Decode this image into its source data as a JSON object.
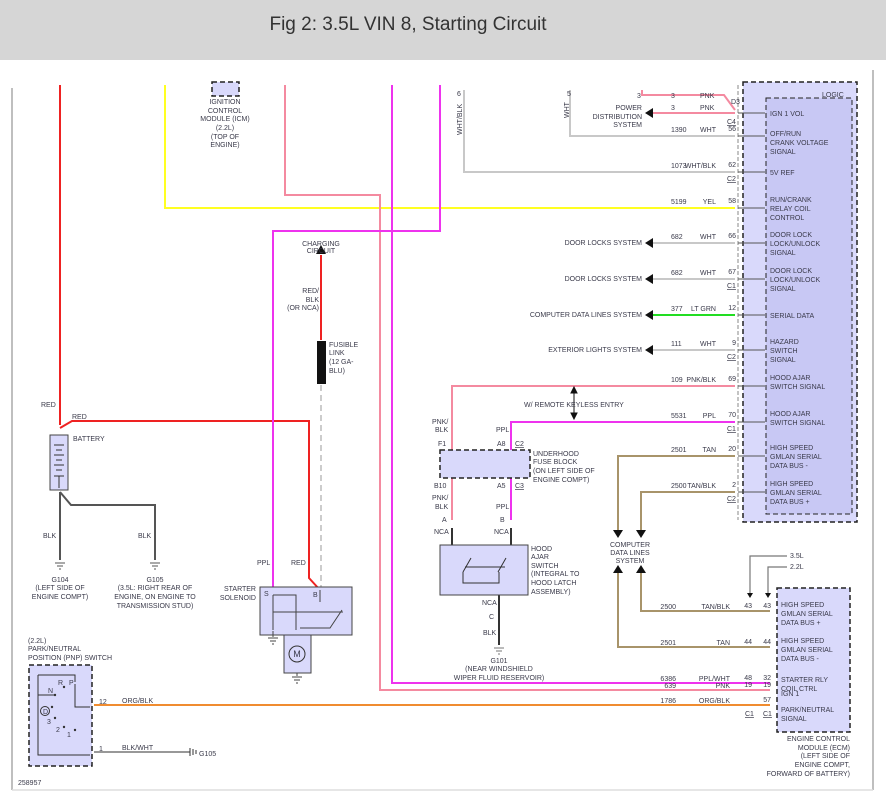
{
  "title": "Fig 2: 3.5L VIN 8, Starting Circuit",
  "figure_id": "258957",
  "colors": {
    "red": "#ee2222",
    "yellow": "#ffff22",
    "pink": "#f48aa0",
    "magenta": "#ee33ee",
    "white": "#c8c8c8",
    "ltgrn": "#22dd22",
    "tan": "#a8946a",
    "orange": "#f08c30",
    "black": "#333333",
    "module_fill": "#d9d9fb"
  },
  "bcm": {
    "logic": "LOGIC",
    "pins": [
      {
        "circuit": "3",
        "color": "PNK",
        "pin": "D3",
        "conn": "C4",
        "signal": [
          "IGN 1 VOL"
        ],
        "dest": [
          "POWER",
          "DISTRIBUTION",
          "SYSTEM"
        ]
      },
      {
        "circuit": "1390",
        "color": "WHT",
        "pin": "56",
        "signal": [
          "OFF/RUN",
          "CRANK VOLTAGE",
          "SIGNAL"
        ]
      },
      {
        "circuit": "1073",
        "color": "WHT/BLK",
        "pin": "62",
        "conn": "C2",
        "signal": [
          "5V REF"
        ]
      },
      {
        "circuit": "5199",
        "color": "YEL",
        "pin": "58",
        "signal": [
          "RUN/CRANK",
          "RELAY COIL",
          "CONTROL"
        ]
      },
      {
        "circuit": "682",
        "color": "WHT",
        "pin": "66",
        "signal": [
          "DOOR LOCK",
          "LOCK/UNLOCK",
          "SIGNAL"
        ],
        "dest": "DOOR LOCKS SYSTEM"
      },
      {
        "circuit": "682",
        "color": "WHT",
        "pin": "67",
        "conn": "C1",
        "signal": [
          "DOOR LOCK",
          "LOCK/UNLOCK",
          "SIGNAL"
        ],
        "dest": "DOOR LOCKS SYSTEM"
      },
      {
        "circuit": "377",
        "color": "LT GRN",
        "pin": "12",
        "signal": [
          "SERIAL DATA"
        ],
        "dest": "COMPUTER DATA LINES SYSTEM"
      },
      {
        "circuit": "111",
        "color": "WHT",
        "pin": "9",
        "conn": "C2",
        "signal": [
          "HAZARD",
          "SWITCH",
          "SIGNAL"
        ],
        "dest": "EXTERIOR LIGHTS SYSTEM"
      },
      {
        "circuit": "109",
        "color": "PNK/BLK",
        "pin": "69",
        "signal": [
          "HOOD AJAR",
          "SWITCH SIGNAL"
        ]
      },
      {
        "circuit": "5531",
        "color": "PPL",
        "pin": "70",
        "conn": "C1",
        "signal": [
          "HOOD AJAR",
          "SWITCH SIGNAL"
        ]
      },
      {
        "circuit": "2501",
        "color": "TAN",
        "pin": "20",
        "signal": [
          "HIGH SPEED",
          "GMLAN SERIAL",
          "DATA BUS -"
        ]
      },
      {
        "circuit": "2500",
        "color": "TAN/BLK",
        "pin": "2",
        "conn": "C2",
        "signal": [
          "HIGH SPEED",
          "GMLAN SERIAL",
          "DATA BUS +"
        ]
      }
    ],
    "top_pins": {
      "pnk": "3",
      "wht": "5",
      "whtblk": "6",
      "wht_label": "WHT",
      "whtblk_label": "WHT/BLK"
    }
  },
  "icm": [
    "IGNITION",
    "CONTROL",
    "MODULE (ICM)",
    "(2.2L)",
    "(TOP OF",
    "ENGINE)"
  ],
  "charging": [
    "CHARGING",
    "CIRCUIT"
  ],
  "fusible_wire": [
    "RED/",
    "BLK",
    "(OR NCA)"
  ],
  "fusible": [
    "FUSIBLE",
    "LINK",
    "(12 GA-",
    "BLU)"
  ],
  "battery": {
    "label": "BATTERY",
    "wire_up": "RED",
    "wire_right": "RED"
  },
  "grounds": {
    "g104": {
      "wire": "BLK",
      "label": [
        "G104",
        "(LEFT SIDE OF",
        "ENGINE COMPT)"
      ]
    },
    "g105": {
      "wire": "BLK",
      "label": [
        "G105",
        "(3.5L: RIGHT REAR OF",
        "ENGINE, ON ENGINE TO",
        "TRANSMISSION STUD)"
      ]
    },
    "g101": {
      "label": [
        "G101",
        "(NEAR WINDSHIELD",
        "WIPER FLUID RESERVOIR)"
      ]
    }
  },
  "starter": {
    "label": [
      "STARTER",
      "SOLENOID"
    ],
    "s": "S",
    "b": "B",
    "wire_s": "PPL",
    "wire_b": "RED",
    "motor": "M"
  },
  "rke": "W/ REMOTE KEYLESS ENTRY",
  "fuse_block": {
    "label": [
      "UNDERHOOD",
      "FUSE BLOCK",
      "(ON LEFT SIDE OF",
      "ENGINE COMPT)"
    ],
    "f1": "F1",
    "b10": "B10",
    "a8": "A8",
    "a5": "A5",
    "c2": "C2",
    "c3": "C3",
    "wire_l": [
      "PNK/",
      "BLK"
    ],
    "wire_r": "PPL"
  },
  "hood_switch": {
    "label": [
      "HOOD",
      "AJAR",
      "SWITCH",
      "(INTEGRAL TO",
      "HOOD LATCH",
      "ASSEMBLY)"
    ],
    "a": "A",
    "b": "B",
    "c": "C",
    "nca": "NCA",
    "blk": "BLK"
  },
  "cdl": [
    "COMPUTER",
    "DATA LINES",
    "SYSTEM"
  ],
  "ecm": {
    "variants": [
      "3.5L",
      "2.2L"
    ],
    "rows": [
      {
        "circuit": "2500",
        "color": "TAN/BLK",
        "p1": "43",
        "p2": "43",
        "signal": [
          "HIGH SPEED",
          "GMLAN SERIAL",
          "DATA BUS +"
        ]
      },
      {
        "circuit": "2501",
        "color": "TAN",
        "p1": "44",
        "p2": "44",
        "signal": [
          "HIGH SPEED",
          "GMLAN SERIAL",
          "DATA BUS -"
        ]
      },
      {
        "circuit": "6386",
        "color": "PPL/WHT",
        "p1": "48",
        "p2": "32",
        "signal": [
          "STARTER RLY",
          "COIL CTRL"
        ]
      },
      {
        "circuit": "639",
        "color": "PNK",
        "p1": "19",
        "p2": "19",
        "signal": [
          "IGN 1"
        ]
      },
      {
        "circuit": "1786",
        "color": "ORG/BLK",
        "p1": "",
        "p2": "57",
        "signal": [
          "PARK/NEUTRAL",
          "SIGNAL"
        ]
      }
    ],
    "conn1": "C1",
    "conn2": "C1",
    "label": [
      "ENGINE CONTROL",
      "MODULE (ECM)",
      "(LEFT SIDE OF",
      "ENGINE COMPT,",
      "FORWARD OF BATTERY)"
    ]
  },
  "pnp": {
    "label": [
      "(2.2L)",
      "PARK/NEUTRAL",
      "POSITION (PNP) SWITCH"
    ],
    "positions": [
      "P",
      "R",
      "N",
      "D",
      "3",
      "2",
      "1"
    ],
    "pin12": "12",
    "pin1": "1",
    "wire12": "ORG/BLK",
    "wire1": "BLK/WHT",
    "ground": "G105"
  }
}
